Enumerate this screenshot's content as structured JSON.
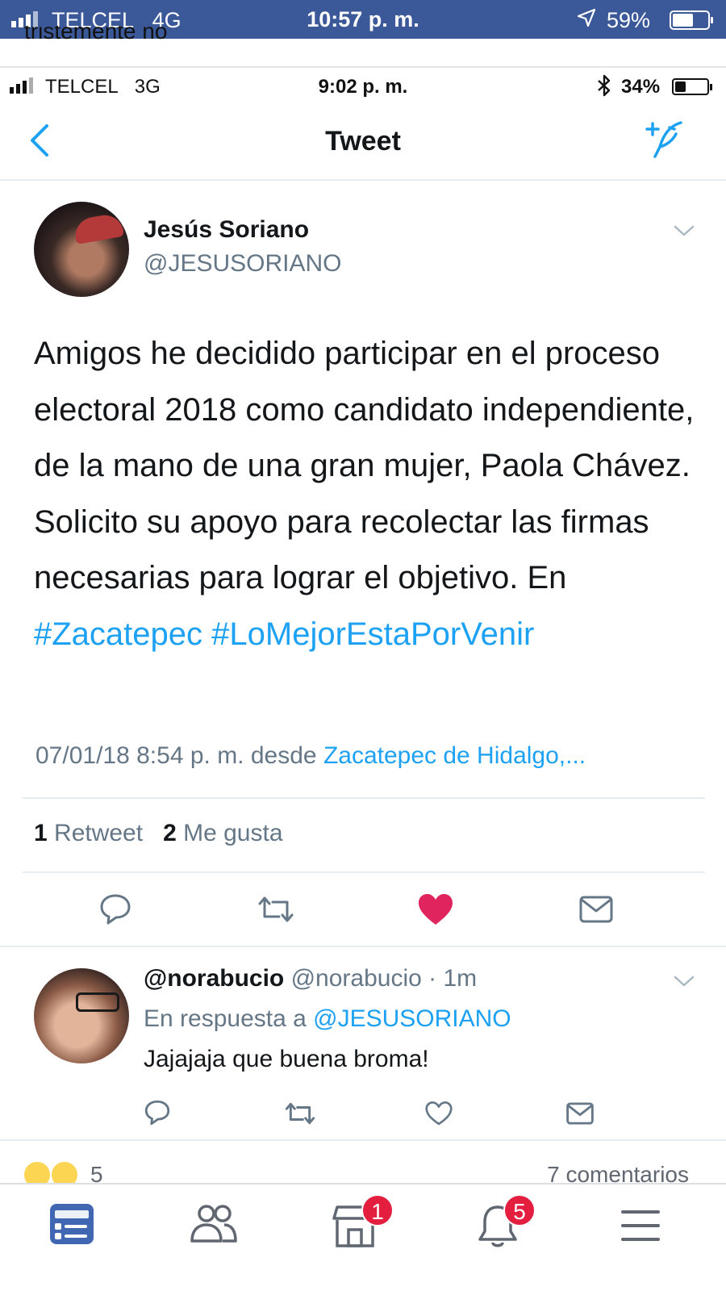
{
  "outer_status": {
    "carrier": "TELCEL",
    "network": "4G",
    "time": "10:57 p. m.",
    "battery": "59%",
    "battery_level": 0.59
  },
  "cut_text": "tristemente no",
  "inner_status": {
    "carrier": "TELCEL",
    "network": "3G",
    "time": "9:02 p. m.",
    "battery": "34%",
    "battery_level": 0.34
  },
  "nav": {
    "title": "Tweet"
  },
  "tweet": {
    "author_name": "Jesús Soriano",
    "author_handle": "@JESUSORIANO",
    "text": "Amigos he decidido participar en el proceso electoral 2018 como candidato independiente, de la mano de una gran mujer, Paola Chávez. Solicito su apoyo para recolectar las firmas necesarias para lograr el objetivo. En ",
    "hashtag1": "#Zacatepec",
    "hashtag2": "#LoMejorEstaPorVenir",
    "timestamp": "07/01/18 8:54 p. m. desde ",
    "location": "Zacatepec de Hidalgo,...",
    "retweet_count": "1",
    "retweet_label": " Retweet",
    "like_count": "2",
    "like_label": " Me gusta",
    "liked": true
  },
  "reply": {
    "name": "@norabucio",
    "handle": " @norabucio · 1m",
    "reply_to_label": "En respuesta a ",
    "reply_to_mention": "@JESUSORIANO",
    "text": "Jajajaja que buena broma!"
  },
  "fb": {
    "reaction_count": "5",
    "comments": "7 comentarios",
    "marketplace_badge": "1",
    "notifications_badge": "5"
  },
  "colors": {
    "twitter_blue": "#1da1f2",
    "like_red": "#e0245e",
    "fb_blue": "#3b5998",
    "fb_active": "#4267b2"
  }
}
